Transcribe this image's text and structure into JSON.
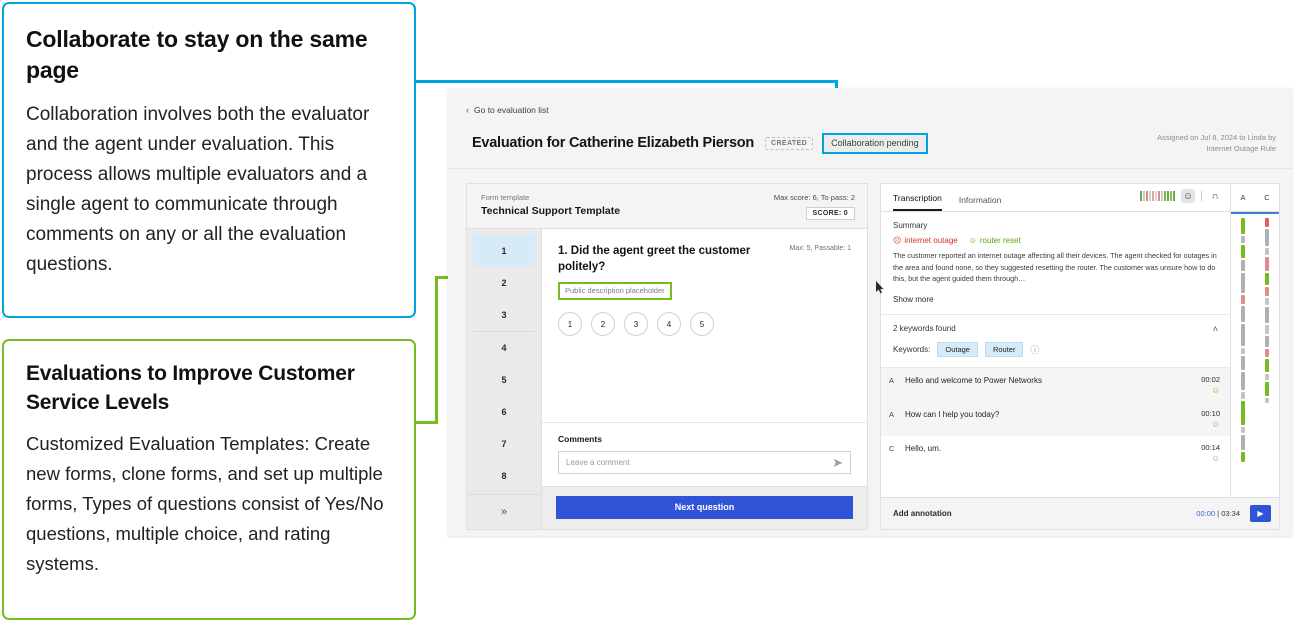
{
  "callouts": [
    {
      "id": "collaborate",
      "accent": "#00a3e0",
      "title": "Collaborate to stay on the same page",
      "body": "Collaboration involves both the evaluator and the agent under evaluation. This process allows multiple evaluators and a single agent to communicate through comments on any or all the evaluation questions."
    },
    {
      "id": "evaluations",
      "accent": "#76bc21",
      "title": "Evaluations to Improve Customer Service Levels",
      "body": "Customized Evaluation Templates: Create new forms, clone forms, and set up multiple forms, Types of questions consist of Yes/No questions, multiple choice, and rating systems."
    }
  ],
  "app": {
    "breadcrumb": {
      "chevron": "‹",
      "label": "Go to evaluation list"
    },
    "header": {
      "title": "Evaluation for Catherine Elizabeth Pierson",
      "badge_created": "CREATED",
      "badge_collaboration": "Collaboration pending",
      "assigned_line1": "Assigned on Jul 8, 2024 to Linda by",
      "assigned_line2": "Internet Outage Rule"
    },
    "form": {
      "template_label": "Form template",
      "template_name": "Technical Support Template",
      "scores_line": "Max score: 6,  To pass: 2",
      "score_chip": "SCORE: 0",
      "question_nav": [
        "1",
        "2",
        "3",
        "4",
        "5",
        "6",
        "7",
        "8"
      ],
      "question_nav_active_index": 0,
      "expand_icon": "»",
      "question": {
        "title": "1. Did the agent greet the customer politely?",
        "meta": "Max: 5, Passable: 1",
        "description": "Public description placeholder",
        "ratings": [
          "1",
          "2",
          "3",
          "4",
          "5"
        ]
      },
      "comments": {
        "label": "Comments",
        "placeholder": "Leave a comment",
        "send_icon": "➤"
      },
      "next_button": "Next question"
    },
    "transcription": {
      "tabs": [
        {
          "label": "Transcription",
          "active": true
        },
        {
          "label": "Information",
          "active": false
        }
      ],
      "tools": {
        "sentiment_strip": [
          "#6aa84f",
          "#c9c9c9",
          "#d98880",
          "#cfcfcf",
          "#e8a0a0",
          "#d6d6d6",
          "#e08b8b",
          "#cfcfcf",
          "#7ab648",
          "#6aa84f",
          "#8bc34a",
          "#6aa84f"
        ],
        "smiley_icon": "☺",
        "headphone_icon": "∩"
      },
      "summary": {
        "title": "Summary",
        "topics": [
          {
            "label": "internet outage",
            "sentiment": "negative",
            "icon": "☹",
            "color": "#d9322a"
          },
          {
            "label": "router reset",
            "sentiment": "positive",
            "icon": "☺",
            "color": "#5ba800"
          }
        ],
        "text": "The customer reported an internet outage affecting all their devices. The agent checked for outages in the area and found none, so they suggested resetting the router. The customer was unsure how to do this, but the agent guided them through…",
        "show_more": "Show more"
      },
      "keywords": {
        "header": "2 keywords found",
        "chevron": "˄",
        "label": "Keywords:",
        "chips": [
          "Outage",
          "Router"
        ],
        "info_icon": "ⓘ"
      },
      "messages": [
        {
          "speaker": "A",
          "text": "Hello and welcome to Power Networks",
          "time": "00:02",
          "emoji": "☺",
          "emoji_tone": "green"
        },
        {
          "speaker": "A",
          "text": "How can I help you today?",
          "time": "00:10",
          "emoji": "☺",
          "emoji_tone": "gray"
        },
        {
          "speaker": "C",
          "text": "Hello, um.",
          "time": "00:14",
          "emoji": "☺",
          "emoji_tone": "gray"
        }
      ],
      "sentiment_columns": {
        "headers": [
          "A",
          "C"
        ],
        "a_track": [
          {
            "h": 16,
            "c": "#76bc21"
          },
          {
            "h": 7,
            "c": "#b9b9b9"
          },
          {
            "h": 13,
            "c": "#76bc21"
          },
          {
            "h": 11,
            "c": "#b0b0b0"
          },
          {
            "h": 20,
            "c": "#b0b0b0"
          },
          {
            "h": 9,
            "c": "#e08b8b"
          },
          {
            "h": 16,
            "c": "#b0b0b0"
          },
          {
            "h": 22,
            "c": "#b0b0b0"
          },
          {
            "h": 6,
            "c": "#c4c4c4"
          },
          {
            "h": 14,
            "c": "#b0b0b0"
          },
          {
            "h": 18,
            "c": "#b0b0b0"
          },
          {
            "h": 7,
            "c": "#c4c4c4"
          },
          {
            "h": 24,
            "c": "#76bc21"
          },
          {
            "h": 6,
            "c": "#c4c4c4"
          },
          {
            "h": 15,
            "c": "#b0b0b0"
          },
          {
            "h": 10,
            "c": "#76bc21"
          }
        ],
        "c_track": [
          {
            "h": 9,
            "c": "#e06060"
          },
          {
            "h": 17,
            "c": "#b0b0b0"
          },
          {
            "h": 7,
            "c": "#c4c4c4"
          },
          {
            "h": 14,
            "c": "#e08b8b"
          },
          {
            "h": 12,
            "c": "#76bc21"
          },
          {
            "h": 9,
            "c": "#e08b8b"
          },
          {
            "h": 7,
            "c": "#c4c4c4"
          },
          {
            "h": 16,
            "c": "#b0b0b0"
          },
          {
            "h": 9,
            "c": "#c4c4c4"
          },
          {
            "h": 11,
            "c": "#b0b0b0"
          },
          {
            "h": 8,
            "c": "#e08b8b"
          },
          {
            "h": 13,
            "c": "#76bc21"
          },
          {
            "h": 6,
            "c": "#c4c4c4"
          },
          {
            "h": 14,
            "c": "#76bc21"
          },
          {
            "h": 5,
            "c": "#c4c4c4"
          }
        ]
      },
      "footer": {
        "add_annotation": "Add annotation",
        "current_time": "00:00",
        "separator": "|",
        "total_time": "03:34",
        "play_icon": "▶"
      }
    }
  }
}
